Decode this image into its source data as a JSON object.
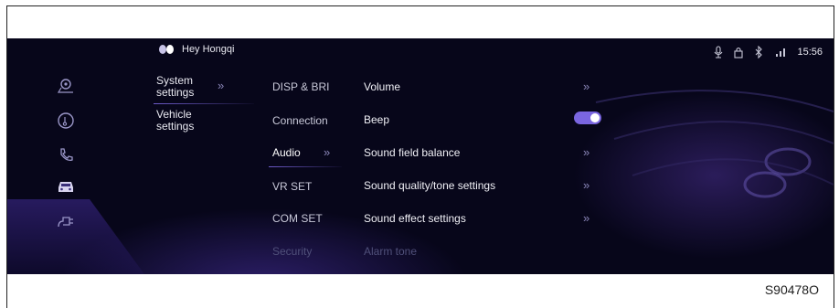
{
  "header": {
    "wake_word": "Hey Hongqi",
    "time": "15:56",
    "status_icons": [
      "mic-icon",
      "lock-icon",
      "bluetooth-icon",
      "signal-icon"
    ]
  },
  "rail": {
    "icons": [
      "navigation-icon",
      "music-icon",
      "phone-icon",
      "car-icon",
      "charging-icon"
    ],
    "active": "car-icon"
  },
  "category_menu": {
    "items": [
      {
        "label": "System settings",
        "active": true
      },
      {
        "label": "Vehicle settings",
        "active": false
      }
    ]
  },
  "sub_menu": {
    "items": [
      "DISP & BRI",
      "Connection",
      "Audio",
      "VR SET",
      "COM SET",
      "Security"
    ],
    "active": "Audio"
  },
  "audio_settings": {
    "items": [
      {
        "label": "Volume",
        "control": "chevron"
      },
      {
        "label": "Beep",
        "control": "toggle",
        "on": true
      },
      {
        "label": "Sound field balance",
        "control": "chevron"
      },
      {
        "label": "Sound quality/tone settings",
        "control": "chevron"
      },
      {
        "label": "Sound effect settings",
        "control": "chevron"
      },
      {
        "label": "Alarm tone",
        "control": "none"
      }
    ]
  },
  "figure_code": "S90478O",
  "colors": {
    "background": "#07061a",
    "accent": "#7a66e0",
    "text": "#e8e8f0"
  }
}
